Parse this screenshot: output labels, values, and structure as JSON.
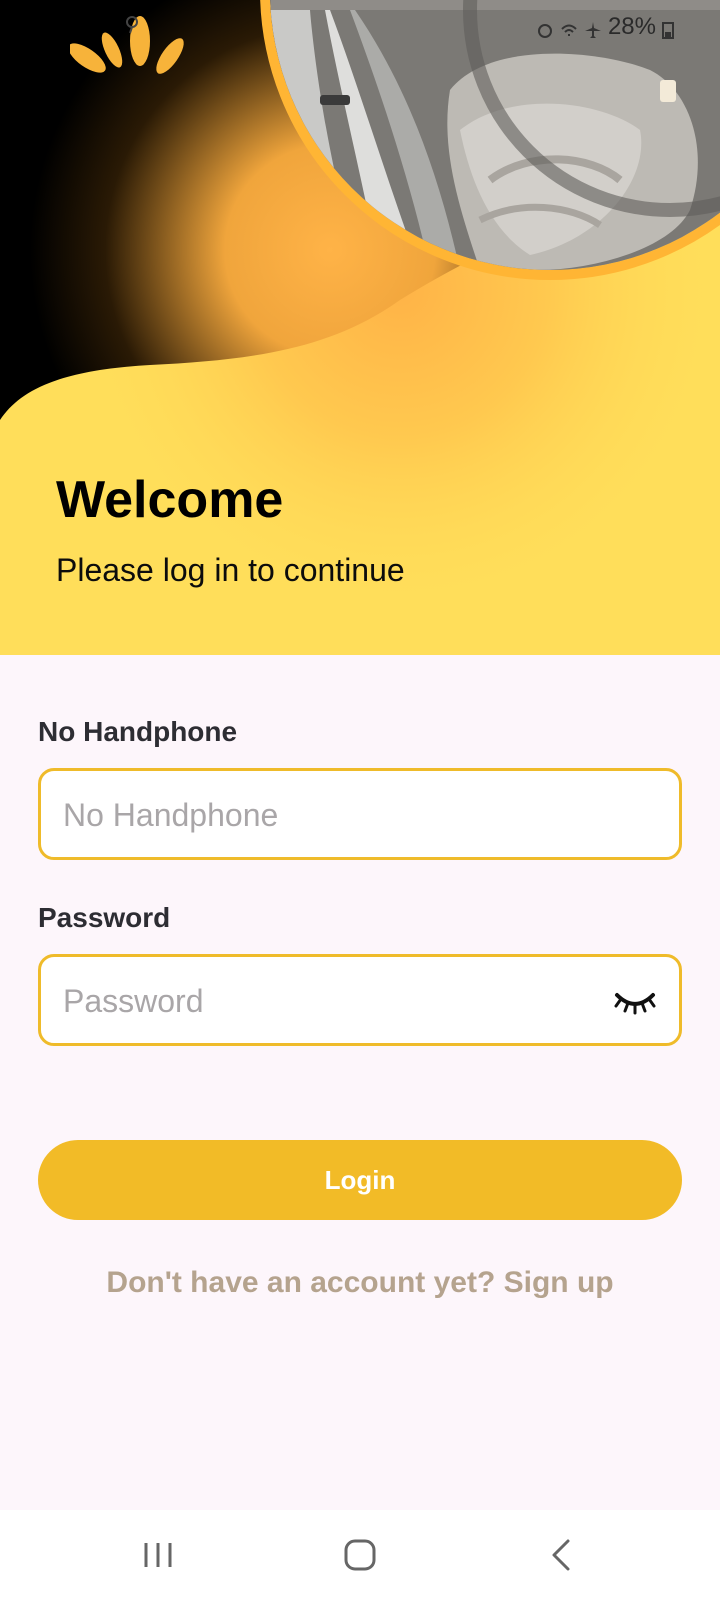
{
  "status_bar": {
    "battery": "28%"
  },
  "welcome": {
    "title": "Welcome",
    "subtitle": "Please log in to continue"
  },
  "form": {
    "phone": {
      "label": "No Handphone",
      "placeholder": "No Handphone",
      "value": ""
    },
    "password": {
      "label": "Password",
      "placeholder": "Password",
      "value": "",
      "toggle_icon": "eye-closed-icon"
    },
    "login_label": "Login",
    "signup_text": "Don't have an account yet? Sign up"
  },
  "nav": {
    "recents_icon": "recents-icon",
    "home_icon": "home-icon",
    "back_icon": "back-icon"
  },
  "colors": {
    "accent": "#f2bb27",
    "field_border": "#efbb2a",
    "hero_yellow": "#ffde5a",
    "signup_text": "#b5a38e",
    "background": "#fdf6fb"
  }
}
